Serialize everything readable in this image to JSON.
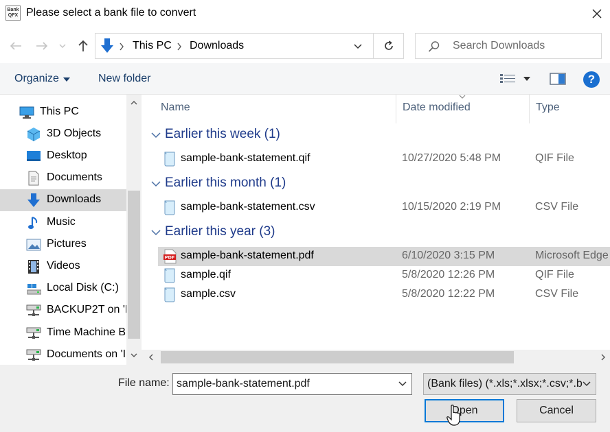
{
  "window": {
    "app_icon_text": "Bank QFX",
    "title": "Please select a bank file to convert",
    "close_glyph": "✕"
  },
  "address": {
    "breadcrumbs": [
      "This PC",
      "Downloads"
    ],
    "search_placeholder": "Search Downloads"
  },
  "toolbar": {
    "organize_label": "Organize",
    "new_folder_label": "New folder",
    "help_glyph": "?"
  },
  "nav": {
    "items": [
      {
        "label": "This PC",
        "icon": "computer-icon"
      },
      {
        "label": "3D Objects",
        "icon": "cube-icon"
      },
      {
        "label": "Desktop",
        "icon": "desktop-icon"
      },
      {
        "label": "Documents",
        "icon": "documents-icon"
      },
      {
        "label": "Downloads",
        "icon": "download-arrow-icon",
        "selected": true
      },
      {
        "label": "Music",
        "icon": "music-note-icon"
      },
      {
        "label": "Pictures",
        "icon": "pictures-icon"
      },
      {
        "label": "Videos",
        "icon": "film-icon"
      },
      {
        "label": "Local Disk (C:)",
        "icon": "local-disk-icon"
      },
      {
        "label": "BACKUP2T on 'M",
        "icon": "network-drive-icon"
      },
      {
        "label": "Time Machine B",
        "icon": "network-drive-icon"
      },
      {
        "label": "Documents on 'I",
        "icon": "network-drive-icon"
      }
    ]
  },
  "columns": {
    "name": "Name",
    "date_modified": "Date modified",
    "type": "Type"
  },
  "groups": [
    {
      "label": "Earlier this week (1)",
      "files": [
        {
          "name": "sample-bank-statement.qif",
          "date": "10/27/2020 5:48 PM",
          "type": "QIF File",
          "icon": "text-file-icon"
        }
      ]
    },
    {
      "label": "Earlier this month (1)",
      "files": [
        {
          "name": "sample-bank-statement.csv",
          "date": "10/15/2020 2:19 PM",
          "type": "CSV File",
          "icon": "text-file-icon"
        }
      ]
    },
    {
      "label": "Earlier this year (3)",
      "files": [
        {
          "name": "sample-bank-statement.pdf",
          "date": "6/10/2020 3:15 PM",
          "type": "Microsoft Edge",
          "icon": "pdf-icon",
          "selected": true
        },
        {
          "name": "sample.qif",
          "date": "5/8/2020 12:26 PM",
          "type": "QIF File",
          "icon": "text-file-icon"
        },
        {
          "name": "sample.csv",
          "date": "5/8/2020 12:22 PM",
          "type": "CSV File",
          "icon": "text-file-icon"
        }
      ]
    }
  ],
  "footer": {
    "file_name_label": "File name:",
    "file_name_value": "sample-bank-statement.pdf",
    "filter_value": "(Bank files) (*.xls;*.xlsx;*.csv;*.b",
    "open_label": "Open",
    "cancel_label": "Cancel"
  },
  "colors": {
    "accent": "#0078d7",
    "group_header": "#1e3a8a",
    "selection": "#d9d9d9"
  }
}
